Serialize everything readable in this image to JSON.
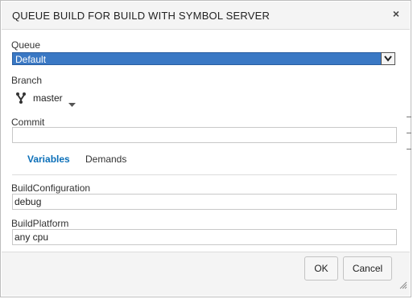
{
  "dialog": {
    "title": "QUEUE BUILD FOR BUILD WITH SYMBOL SERVER",
    "close_label": "×"
  },
  "queue": {
    "label": "Queue",
    "value": "Default"
  },
  "branch": {
    "label": "Branch",
    "value": "master"
  },
  "commit": {
    "label": "Commit",
    "value": ""
  },
  "tabs": [
    {
      "label": "Variables",
      "active": true
    },
    {
      "label": "Demands",
      "active": false
    }
  ],
  "variables": [
    {
      "name": "BuildConfiguration",
      "value": "debug"
    },
    {
      "name": "BuildPlatform",
      "value": "any cpu"
    }
  ],
  "buttons": {
    "ok": "OK",
    "cancel": "Cancel"
  },
  "colors": {
    "accent": "#0b6fb8",
    "selection": "#3a78c4"
  }
}
